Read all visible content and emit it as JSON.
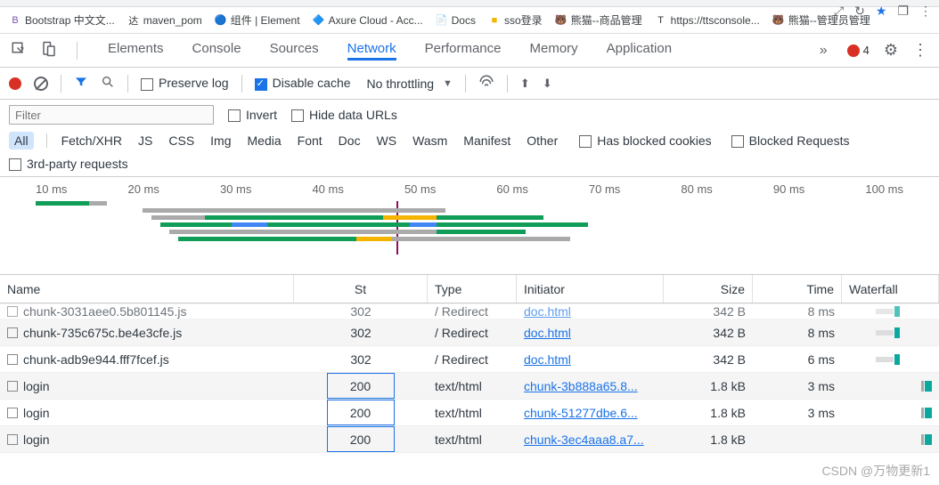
{
  "browser": {
    "bookmarks": [
      {
        "icon": "B",
        "label": "Bootstrap 中文文...",
        "color": "#7952b3"
      },
      {
        "icon": "达",
        "label": "maven_pom",
        "color": "#333"
      },
      {
        "icon": "🔵",
        "label": "组件 | Element",
        "color": "#409eff"
      },
      {
        "icon": "🔷",
        "label": "Axure Cloud - Acc...",
        "color": "#1485cc"
      },
      {
        "icon": "📄",
        "label": "Docs",
        "color": "#4285f4"
      },
      {
        "icon": "■",
        "label": "sso登录",
        "color": "#f4b400"
      },
      {
        "icon": "🐻",
        "label": "熊猫--商品管理",
        "color": "#333"
      },
      {
        "icon": "T",
        "label": "https://ttsconsole...",
        "color": "#333"
      },
      {
        "icon": "🐻",
        "label": "熊猫--管理员管理",
        "color": "#333"
      }
    ]
  },
  "devtools": {
    "tabs": [
      "Elements",
      "Console",
      "Sources",
      "Network",
      "Performance",
      "Memory",
      "Application"
    ],
    "active_tab": "Network",
    "errors": "4",
    "toolbar": {
      "preserve_log": "Preserve log",
      "disable_cache": "Disable cache",
      "throttling": "No throttling"
    },
    "filter": {
      "placeholder": "Filter",
      "invert": "Invert",
      "hide_data": "Hide data URLs",
      "types": [
        "All",
        "Fetch/XHR",
        "JS",
        "CSS",
        "Img",
        "Media",
        "Font",
        "Doc",
        "WS",
        "Wasm",
        "Manifest",
        "Other"
      ],
      "has_blocked": "Has blocked cookies",
      "blocked_req": "Blocked Requests",
      "third_party": "3rd-party requests"
    },
    "timeline": {
      "ticks": [
        "10 ms",
        "20 ms",
        "30 ms",
        "40 ms",
        "50 ms",
        "60 ms",
        "70 ms",
        "80 ms",
        "90 ms",
        "100 ms"
      ]
    },
    "columns": {
      "name": "Name",
      "status": "St",
      "type": "Type",
      "initiator": "Initiator",
      "size": "Size",
      "time": "Time",
      "waterfall": "Waterfall"
    },
    "rows": [
      {
        "name": "chunk-3031aee0.5b801145.js",
        "status": "302",
        "type": "/ Redirect",
        "initiator": "doc.html",
        "size": "342 B",
        "time": "8 ms",
        "cut": true
      },
      {
        "name": "chunk-735c675c.be4e3cfe.js",
        "status": "302",
        "type": "/ Redirect",
        "initiator": "doc.html",
        "size": "342 B",
        "time": "8 ms"
      },
      {
        "name": "chunk-adb9e944.fff7fcef.js",
        "status": "302",
        "type": "/ Redirect",
        "initiator": "doc.html",
        "size": "342 B",
        "time": "6 ms"
      },
      {
        "name": "login",
        "status": "200",
        "type": "text/html",
        "initiator": "chunk-3b888a65.8...",
        "size": "1.8 kB",
        "time": "3 ms",
        "boxed": true
      },
      {
        "name": "login",
        "status": "200",
        "type": "text/html",
        "initiator": "chunk-51277dbe.6...",
        "size": "1.8 kB",
        "time": "3 ms",
        "boxed": true
      },
      {
        "name": "login",
        "status": "200",
        "type": "text/html",
        "initiator": "chunk-3ec4aaa8.a7...",
        "size": "1.8 kB",
        "time": "",
        "boxed": true
      }
    ]
  },
  "watermark": "CSDN @万物更新1"
}
